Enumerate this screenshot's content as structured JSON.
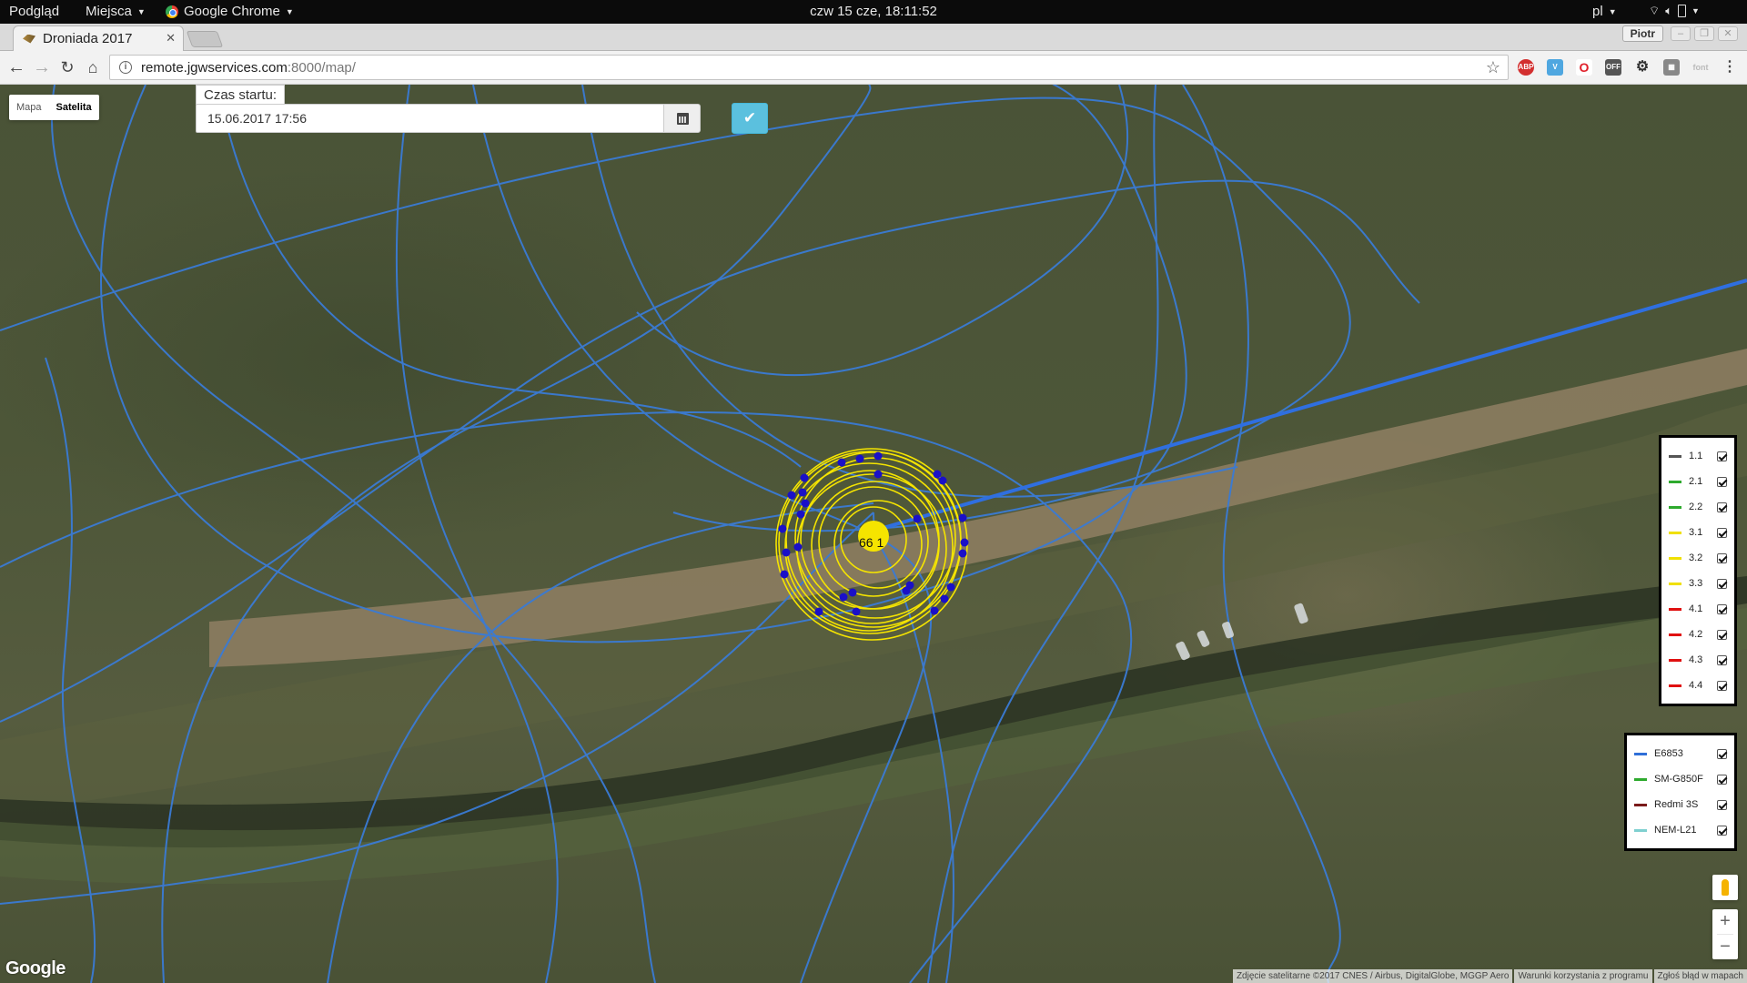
{
  "system_bar": {
    "activities": "Podgląd",
    "places": "Miejsca",
    "app": "Google Chrome",
    "clock": "czw 15 cze, 18:11:52",
    "lang": "pl"
  },
  "browser": {
    "tab_title": "Droniada 2017",
    "profile": "Piotr",
    "url_host": "remote.jgwservices.com",
    "url_path": ":8000/map/",
    "extensions": [
      "ABP",
      "V",
      "O",
      "OFF",
      "gear",
      "grid",
      "font"
    ]
  },
  "map": {
    "map_type_options": [
      "Mapa",
      "Satelita"
    ],
    "active_map_type": "Satelita",
    "start_label": "Czas startu:",
    "start_value": "15.06.2017 17:56",
    "marker_label": "66 1",
    "route_color": "#3a7bd5",
    "circle_color": "#f5e400",
    "point_color": "#1a10c8",
    "google_logo": "Google",
    "attribution": [
      "Zdjęcie satelitarne ©2017 CNES / Airbus, DigitalGlobe, MGGP Aero",
      "Warunki korzystania z programu",
      "Zgłoś błąd w mapach"
    ]
  },
  "legend_tasks": [
    {
      "label": "1.1",
      "color": "#555555",
      "checked": true
    },
    {
      "label": "2.1",
      "color": "#2eaa2e",
      "checked": true
    },
    {
      "label": "2.2",
      "color": "#2eaa2e",
      "checked": true
    },
    {
      "label": "3.1",
      "color": "#f0e000",
      "checked": true
    },
    {
      "label": "3.2",
      "color": "#f0e000",
      "checked": true
    },
    {
      "label": "3.3",
      "color": "#f0e000",
      "checked": true
    },
    {
      "label": "4.1",
      "color": "#e01010",
      "checked": true
    },
    {
      "label": "4.2",
      "color": "#e01010",
      "checked": true
    },
    {
      "label": "4.3",
      "color": "#e01010",
      "checked": true
    },
    {
      "label": "4.4",
      "color": "#e01010",
      "checked": true
    }
  ],
  "legend_devices": [
    {
      "label": "E6853",
      "color": "#2f6fd8",
      "checked": true
    },
    {
      "label": "SM-G850F",
      "color": "#2eaa2e",
      "checked": true
    },
    {
      "label": "Redmi 3S",
      "color": "#7a1a1a",
      "checked": true
    },
    {
      "label": "NEM-L21",
      "color": "#7fd0d0",
      "checked": true
    }
  ]
}
